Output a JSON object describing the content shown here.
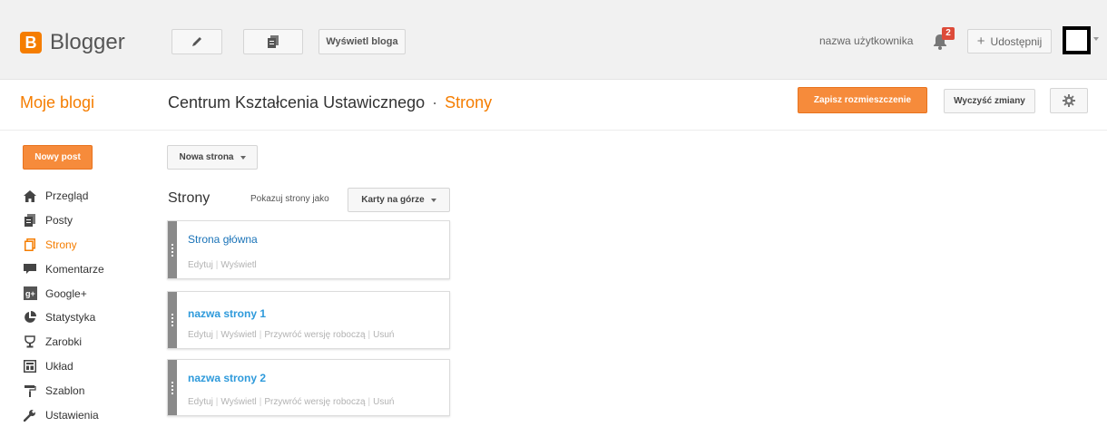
{
  "header": {
    "logo_letter": "B",
    "app_name": "Blogger",
    "edit_icon": "pencil-icon",
    "pages_icon": "document-icon",
    "view_blog_label": "Wyświetl bloga",
    "username": "nazwa użytkownika",
    "notification_count": "2",
    "share_label": "Udostępnij",
    "share_plus": "+"
  },
  "title_row": {
    "my_blogs": "Moje blogi",
    "blog_name": "Centrum Kształcenia Ustawicznego",
    "separator": "·",
    "section": "Strony",
    "save_label": "Zapisz rozmieszczenie",
    "clear_label": "Wyczyść zmiany"
  },
  "sidebar": {
    "new_post_label": "Nowy post",
    "items": [
      {
        "label": "Przegląd",
        "icon": "home-icon",
        "active": false
      },
      {
        "label": "Posty",
        "icon": "posts-icon",
        "active": false
      },
      {
        "label": "Strony",
        "icon": "pages-icon",
        "active": true
      },
      {
        "label": "Komentarze",
        "icon": "comment-icon",
        "active": false
      },
      {
        "label": "Google+",
        "icon": "google-plus-icon",
        "active": false
      },
      {
        "label": "Statystyka",
        "icon": "pie-chart-icon",
        "active": false
      },
      {
        "label": "Zarobki",
        "icon": "trophy-icon",
        "active": false
      },
      {
        "label": "Układ",
        "icon": "layout-icon",
        "active": false
      },
      {
        "label": "Szablon",
        "icon": "paint-roller-icon",
        "active": false
      },
      {
        "label": "Ustawienia",
        "icon": "wrench-icon",
        "active": false
      }
    ]
  },
  "main": {
    "new_page_label": "Nowa strona",
    "section_title": "Strony",
    "show_as_label": "Pokazuj strony jako",
    "show_as_value": "Karty na górze",
    "pages": [
      {
        "name": "Strona główna",
        "actions": [
          "Edytuj",
          "Wyświetl"
        ]
      },
      {
        "name": "nazwa strony 1",
        "actions": [
          "Edytuj",
          "Wyświetl",
          "Przywróć wersję roboczą",
          "Usuń"
        ]
      },
      {
        "name": "nazwa strony 2",
        "actions": [
          "Edytuj",
          "Wyświetl",
          "Przywróć wersję roboczą",
          "Usuń"
        ]
      }
    ]
  },
  "colors": {
    "accent": "#f57d00",
    "link": "#2e9adb",
    "badge": "#dd4b39"
  }
}
